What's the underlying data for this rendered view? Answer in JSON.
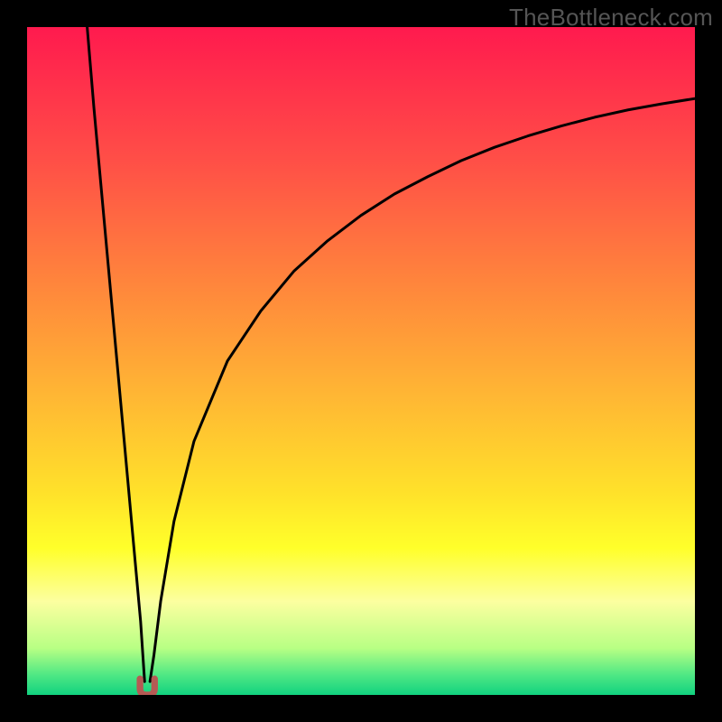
{
  "watermark": "TheBottleneck.com",
  "chart_data": {
    "type": "line",
    "title": "",
    "xlabel": "",
    "ylabel": "",
    "xlim": [
      0,
      100
    ],
    "ylim": [
      0,
      100
    ],
    "grid": false,
    "legend": false,
    "min_point_x": 18,
    "gradient_stops": [
      {
        "pct": 0,
        "color": "#ff1a4e"
      },
      {
        "pct": 20,
        "color": "#ff4f47"
      },
      {
        "pct": 40,
        "color": "#ff8a3b"
      },
      {
        "pct": 55,
        "color": "#ffb634"
      },
      {
        "pct": 70,
        "color": "#ffe22a"
      },
      {
        "pct": 78,
        "color": "#ffff2a"
      },
      {
        "pct": 86,
        "color": "#fcffa0"
      },
      {
        "pct": 93,
        "color": "#b8ff84"
      },
      {
        "pct": 97,
        "color": "#4fe884"
      },
      {
        "pct": 100,
        "color": "#11d27f"
      }
    ],
    "series": [
      {
        "name": "left_branch",
        "stroke": "#000000",
        "x": [
          9,
          10,
          11,
          12,
          13,
          14,
          15,
          16,
          17,
          17.6
        ],
        "y": [
          100,
          88,
          77,
          66,
          55,
          44,
          33,
          22,
          11,
          2
        ]
      },
      {
        "name": "right_branch",
        "stroke": "#000000",
        "x": [
          18.4,
          19,
          20,
          22,
          25,
          30,
          35,
          40,
          45,
          50,
          55,
          60,
          65,
          70,
          75,
          80,
          85,
          90,
          95,
          100
        ],
        "y": [
          2,
          6,
          14,
          26,
          38,
          50,
          57.5,
          63.5,
          68,
          71.8,
          75,
          77.6,
          80,
          82,
          83.7,
          85.2,
          86.5,
          87.6,
          88.5,
          89.3
        ]
      }
    ],
    "marker": {
      "name": "min_marker",
      "shape": "u_shape",
      "color": "#b55a54",
      "x": 18,
      "y": 1.2,
      "width_x": 2.2,
      "height_y": 2.4
    }
  }
}
